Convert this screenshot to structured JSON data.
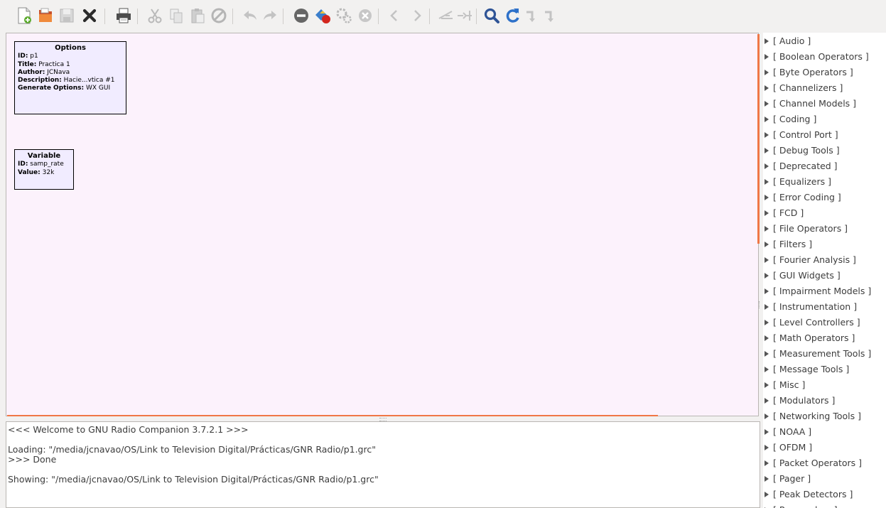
{
  "toolbar": {
    "buttons": [
      {
        "name": "new-icon",
        "enabled": true
      },
      {
        "name": "open-icon",
        "enabled": true
      },
      {
        "name": "save-icon",
        "enabled": false
      },
      {
        "name": "close-icon",
        "enabled": true
      },
      {
        "name": "print-icon",
        "enabled": true
      },
      {
        "name": "cut-icon",
        "enabled": false
      },
      {
        "name": "copy-icon",
        "enabled": false
      },
      {
        "name": "paste-icon",
        "enabled": false
      },
      {
        "name": "delete-icon",
        "enabled": false
      },
      {
        "name": "undo-icon",
        "enabled": false
      },
      {
        "name": "redo-icon",
        "enabled": false
      },
      {
        "name": "disable-block-icon",
        "enabled": true
      },
      {
        "name": "generate-icon",
        "enabled": true
      },
      {
        "name": "execute-icon",
        "enabled": false
      },
      {
        "name": "kill-icon",
        "enabled": false
      },
      {
        "name": "rotate-ccw-icon",
        "enabled": false
      },
      {
        "name": "rotate-cw-icon",
        "enabled": false
      },
      {
        "name": "enable-icon",
        "enabled": false
      },
      {
        "name": "disable-icon",
        "enabled": false
      },
      {
        "name": "find-icon",
        "enabled": true
      },
      {
        "name": "reload-icon",
        "enabled": true
      },
      {
        "name": "bypass-icon",
        "enabled": false
      },
      {
        "name": "bypass2-icon",
        "enabled": false
      }
    ]
  },
  "canvas": {
    "options_block": {
      "title": "Options",
      "rows": [
        {
          "key": "ID:",
          "value": " p1"
        },
        {
          "key": "Title:",
          "value": " Practica 1"
        },
        {
          "key": "Author:",
          "value": " JCNava"
        },
        {
          "key": "Description:",
          "value": " Hacie...vtica #1"
        },
        {
          "key": "Generate Options:",
          "value": " WX GUI"
        }
      ]
    },
    "variable_block": {
      "title": "Variable",
      "rows": [
        {
          "key": "ID:",
          "value": " samp_rate"
        },
        {
          "key": "Value:",
          "value": " 32k"
        }
      ]
    }
  },
  "console": {
    "lines": [
      "<<< Welcome to GNU Radio Companion 3.7.2.1 >>>",
      "",
      "Loading: \"/media/jcnavao/OS/Link to Television Digital/Prácticas/GNR Radio/p1.grc\"",
      ">>> Done",
      "",
      "Showing: \"/media/jcnavao/OS/Link to Television Digital/Prácticas/GNR Radio/p1.grc\""
    ]
  },
  "block_tree": {
    "items": [
      "[ Audio ]",
      "[ Boolean Operators ]",
      "[ Byte Operators ]",
      "[ Channelizers ]",
      "[ Channel Models ]",
      "[ Coding ]",
      "[ Control Port ]",
      "[ Debug Tools ]",
      "[ Deprecated ]",
      "[ Equalizers ]",
      "[ Error Coding ]",
      "[ FCD ]",
      "[ File Operators ]",
      "[ Filters ]",
      "[ Fourier Analysis ]",
      "[ GUI Widgets ]",
      "[ Impairment Models ]",
      "[ Instrumentation ]",
      "[ Level Controllers ]",
      "[ Math Operators ]",
      "[ Measurement Tools ]",
      "[ Message Tools ]",
      "[ Misc ]",
      "[ Modulators ]",
      "[ Networking Tools ]",
      "[ NOAA ]",
      "[ OFDM ]",
      "[ Packet Operators ]",
      "[ Pager ]",
      "[ Peak Detectors ]",
      "[ Resamplers ]"
    ]
  },
  "colors": {
    "accent": "#f07746",
    "canvas_bg": "#fcf2fc",
    "block_bg": "#f1ecff"
  }
}
